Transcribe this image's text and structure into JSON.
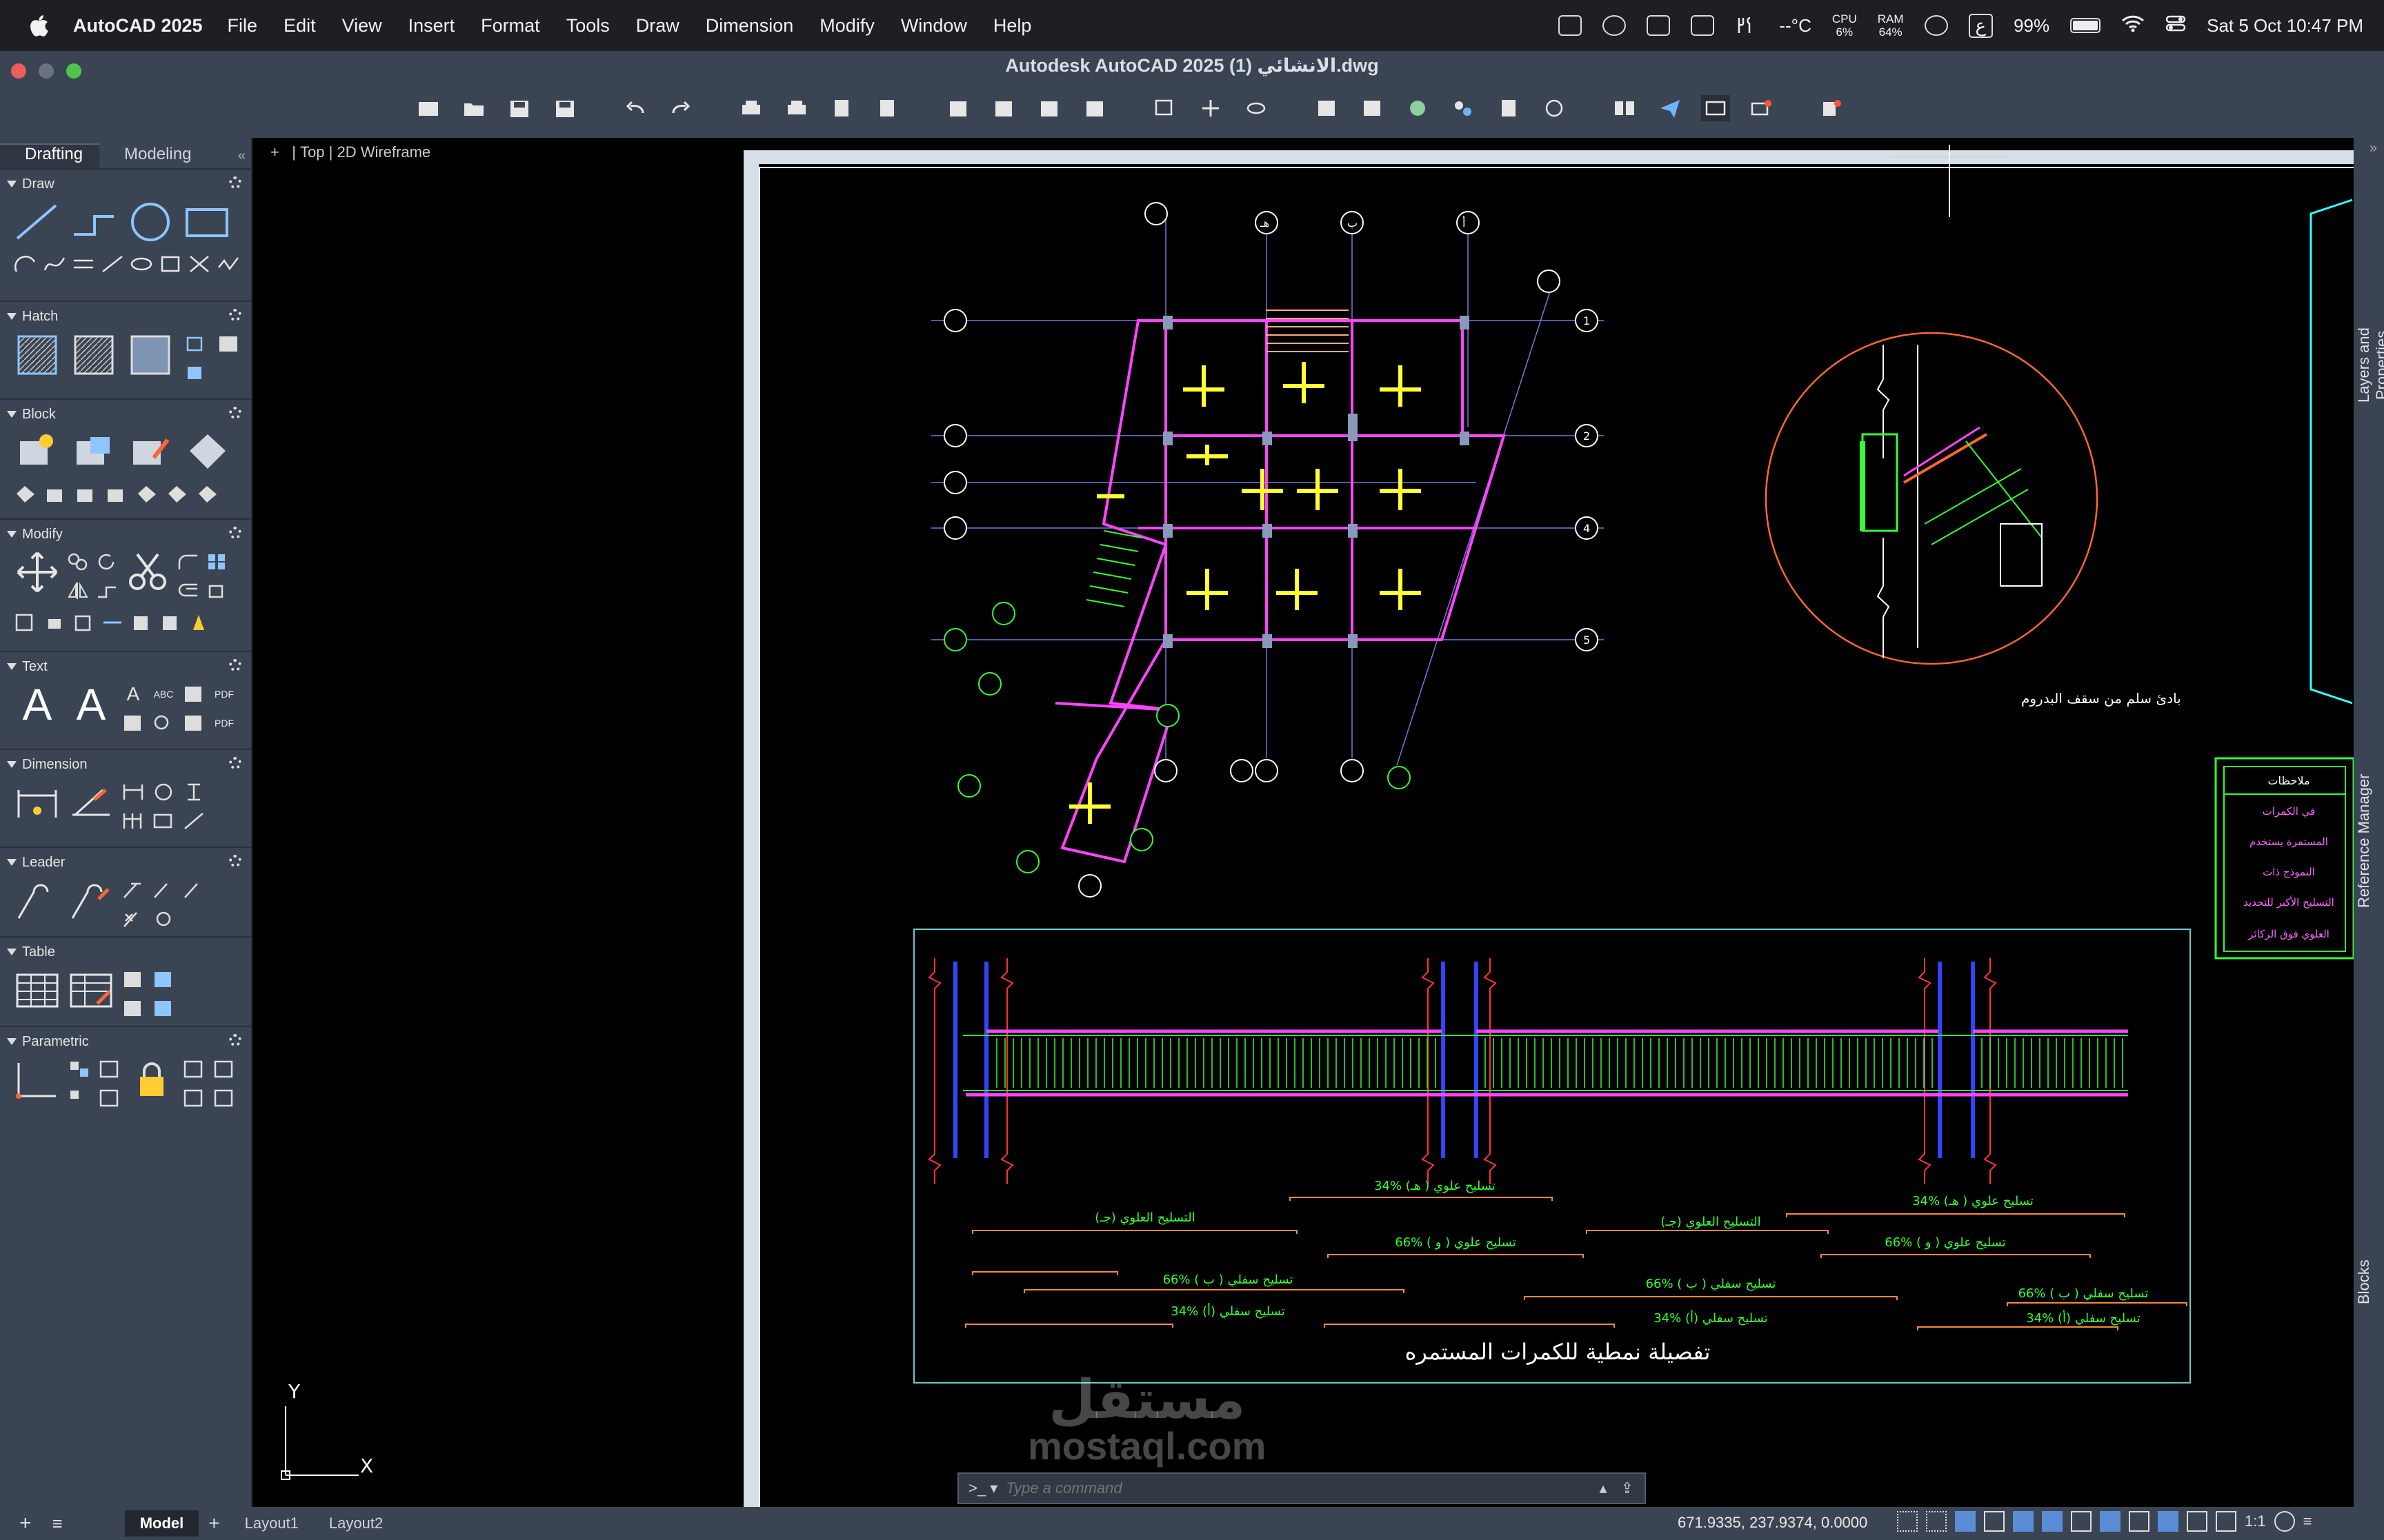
{
  "menubar": {
    "app": "AutoCAD 2025",
    "items": [
      "File",
      "Edit",
      "View",
      "Insert",
      "Format",
      "Tools",
      "Draw",
      "Dimension",
      "Modify",
      "Window",
      "Help"
    ],
    "temp": "--°C",
    "cpu_label": "CPU",
    "cpu_value": "6%",
    "ram_label": "RAM",
    "ram_value": "64%",
    "input_lang": "ع",
    "battery": "99%",
    "datetime": "Sat 5 Oct  10:47 PM"
  },
  "window": {
    "title": "Autodesk AutoCAD 2025   الانشائي (1).dwg"
  },
  "palette": {
    "tabs": [
      "Drafting",
      "Modeling"
    ],
    "active_tab": "Drafting",
    "sections": [
      "Draw",
      "Hatch",
      "Block",
      "Modify",
      "Text",
      "Dimension",
      "Leader",
      "Table",
      "Parametric"
    ]
  },
  "viewport": {
    "controls": "+",
    "view": "Top",
    "style": "2D Wireframe",
    "ucs_y": "Y",
    "ucs_x": "X"
  },
  "drawing": {
    "grid_letters_top": [
      "هـ",
      "د",
      "ب",
      "أ"
    ],
    "grid_numbers_right": [
      "1",
      "2",
      "4",
      "5"
    ],
    "detail_caption": "بادئ سلم من سقف البدروم",
    "beam_title": "تفصيلة نمطية للكمرات المستمره",
    "notes_title": "ملاحظات",
    "notes": [
      "في الكمرات",
      "المستمرة يستخدم",
      "النموذج ذات",
      "التسليح الأكبر للتحديد",
      "العلوي فوق الركائز"
    ],
    "beam_labels": [
      "تسليح علوي ( هـ)  %34",
      "التسليح العلوي (جـ)",
      "تسليح علوي ( و )  %66",
      "تسليح سفلي ( ب )  %66",
      "تسليح سفلي (أ)  %34"
    ]
  },
  "right_panels": [
    "Layers and Properties",
    "Reference Manager",
    "Blocks"
  ],
  "status": {
    "layout_tabs": [
      "Model",
      "Layout1",
      "Layout2"
    ],
    "active_layout": "Model",
    "command_placeholder": "Type a command",
    "coordinates": "671.9335, 237.9374, 0.0000",
    "scale": "1:1"
  },
  "watermark": {
    "line1": "مستقل",
    "line2": "mostaql.com"
  },
  "colors": {
    "menubar_bg": "#1d1f24",
    "chrome_bg": "#3b4453",
    "canvas_bg": "#000000",
    "beam_magenta": "#ff33ff",
    "rebar_green": "#33ff33",
    "column_blue": "#3344ff",
    "highlight_yellow": "#ffff33"
  }
}
